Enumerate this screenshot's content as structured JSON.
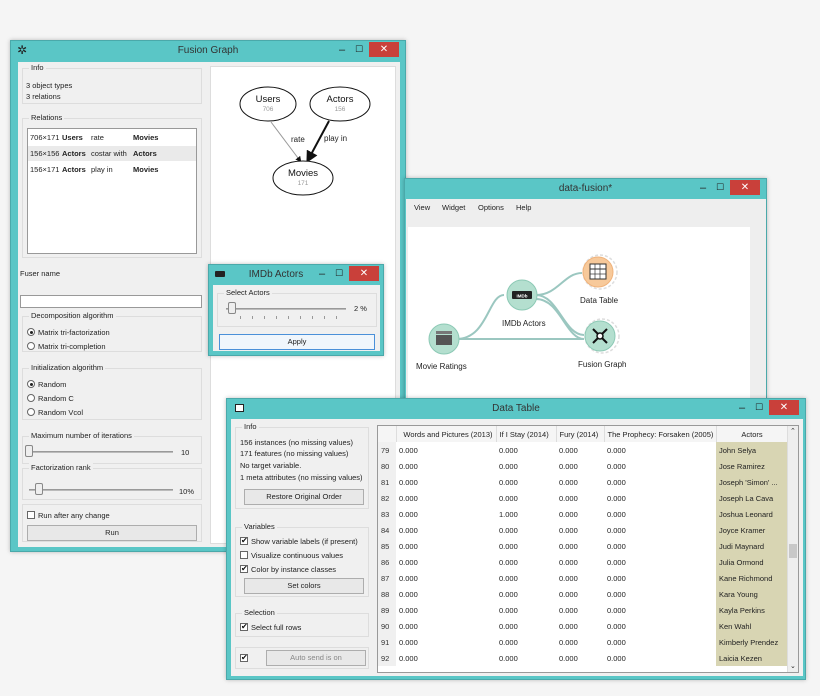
{
  "fusion": {
    "title": "Fusion Graph",
    "info_label": "Info",
    "info_lines": [
      "3 object types",
      "3 relations"
    ],
    "relations_label": "Relations",
    "relations": [
      {
        "shape": "706×171",
        "source": "Users",
        "rel": "rate",
        "target": "Movies"
      },
      {
        "shape": "156×156",
        "source": "Actors",
        "rel": "costar with",
        "target": "Actors"
      },
      {
        "shape": "156×171",
        "source": "Actors",
        "rel": "play in",
        "target": "Movies"
      }
    ],
    "fuser_name_label": "Fuser name",
    "fuser_name_value": "",
    "decomp_label": "Decomposition algorithm",
    "decomp_options": [
      "Matrix tri-factorization",
      "Matrix tri-completion"
    ],
    "init_label": "Initialization algorithm",
    "init_options": [
      "Random",
      "Random C",
      "Random Vcol"
    ],
    "max_iter_label": "Maximum number of iterations",
    "max_iter_value": "10",
    "rank_label": "Factorization rank",
    "rank_value": "10%",
    "run_after_label": "Run after any change",
    "run_label": "Run",
    "graph": {
      "nodes": [
        {
          "name": "Users",
          "count": "706"
        },
        {
          "name": "Actors",
          "count": "156"
        },
        {
          "name": "Movies",
          "count": "171"
        }
      ],
      "edges": [
        "rate",
        "play in"
      ]
    }
  },
  "imdb": {
    "title": "IMDb Actors",
    "select_label": "Select Actors",
    "value": "2 %",
    "apply_label": "Apply"
  },
  "canvas": {
    "title": "data-fusion*",
    "menu": [
      "View",
      "Widget",
      "Options",
      "Help"
    ],
    "widgets": {
      "data_table": "Data Table",
      "imdb": "IMDb Actors",
      "fusion": "Fusion Graph",
      "movie_ratings": "Movie Ratings",
      "imdb_badge": "IMDb"
    }
  },
  "datatable": {
    "title": "Data Table",
    "info_label": "Info",
    "info_lines": [
      "156 instances (no missing values)",
      "171 features (no missing values)",
      "No target variable.",
      "1 meta attributes (no missing values)"
    ],
    "restore_label": "Restore Original Order",
    "variables_label": "Variables",
    "opt_show_labels": "Show variable labels (if present)",
    "opt_visualize": "Visualize continuous values",
    "opt_color": "Color by instance classes",
    "set_colors_label": "Set colors",
    "selection_label": "Selection",
    "select_full_rows": "Select full rows",
    "auto_send": "Auto send is on",
    "columns": [
      "Words and Pictures (2013)",
      "If I Stay (2014)",
      "Fury (2014)",
      "The Prophecy: Forsaken (2005)",
      "Actors"
    ],
    "rows": [
      [
        "79",
        "0.000",
        "0.000",
        "0.000",
        "0.000",
        "John Selya"
      ],
      [
        "80",
        "0.000",
        "0.000",
        "0.000",
        "0.000",
        "Jose Ramirez"
      ],
      [
        "81",
        "0.000",
        "0.000",
        "0.000",
        "0.000",
        "Joseph 'Simon' ..."
      ],
      [
        "82",
        "0.000",
        "0.000",
        "0.000",
        "0.000",
        "Joseph La Cava"
      ],
      [
        "83",
        "0.000",
        "1.000",
        "0.000",
        "0.000",
        "Joshua Leonard"
      ],
      [
        "84",
        "0.000",
        "0.000",
        "0.000",
        "0.000",
        "Joyce Kramer"
      ],
      [
        "85",
        "0.000",
        "0.000",
        "0.000",
        "0.000",
        "Judi Maynard"
      ],
      [
        "86",
        "0.000",
        "0.000",
        "0.000",
        "0.000",
        "Julia Ormond"
      ],
      [
        "87",
        "0.000",
        "0.000",
        "0.000",
        "0.000",
        "Kane Richmond"
      ],
      [
        "88",
        "0.000",
        "0.000",
        "0.000",
        "0.000",
        "Kara Young"
      ],
      [
        "89",
        "0.000",
        "0.000",
        "0.000",
        "0.000",
        "Kayla Perkins"
      ],
      [
        "90",
        "0.000",
        "0.000",
        "0.000",
        "0.000",
        "Ken Wahl"
      ],
      [
        "91",
        "0.000",
        "0.000",
        "0.000",
        "0.000",
        "Kimberly Prendez"
      ],
      [
        "92",
        "0.000",
        "0.000",
        "0.000",
        "0.000",
        "Laicia Kezen"
      ]
    ]
  },
  "colors": {
    "titlebar": "#5ac6c6",
    "close": "#c9403a",
    "node_orange": "#f7c99a",
    "node_green": "#b4dfcf",
    "meta_col": "#d8d5b3"
  }
}
